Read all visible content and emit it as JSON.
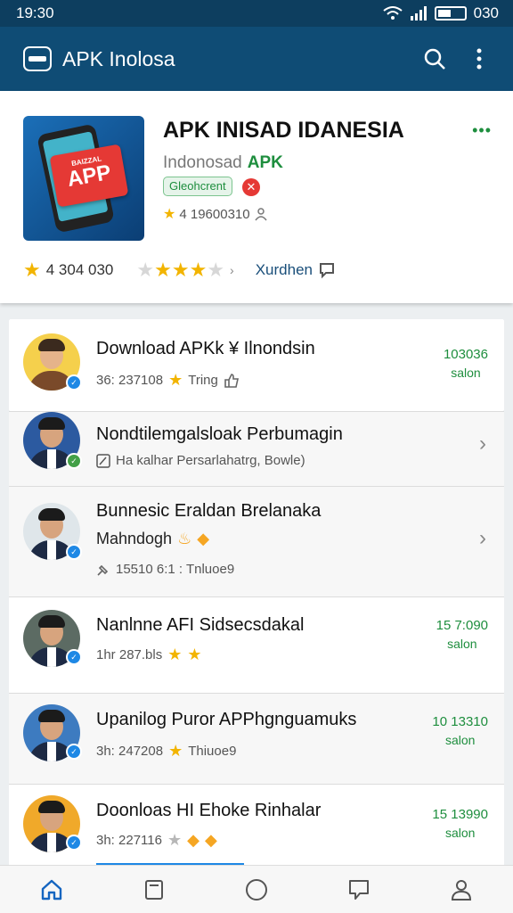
{
  "status": {
    "time": "19:30",
    "right_text": "030"
  },
  "appbar": {
    "title": "APK Inolosa"
  },
  "featured": {
    "title": "APK INISAD IDANESIA",
    "subtitle": "Indonosad",
    "subtitle_accent": "APK",
    "tag": "Gleohcrent",
    "rating_text": "4 19600310",
    "star_rating": 4,
    "rating_count": "4 304 030",
    "second_rating": 3.5,
    "link": "Xurdhen",
    "icon_badge_small": "BAIZZAL",
    "icon_badge_big": "APP"
  },
  "list": [
    {
      "title": "Download APKk ¥ Ilnondsin",
      "meta": "36: 237108",
      "badge": "Tring",
      "right_value": "103036",
      "right_label": "salon"
    },
    {
      "title": "Nondtilemgalsloak Perbumagin",
      "sub": "Ha kalhar Persarlahatrg, Bowle)"
    },
    {
      "title": "Bunnesic Eraldan Brelanaka",
      "line2": "Mahndogh",
      "meta": "15510 6:1 : Tnluoe9"
    },
    {
      "title": "Nanlnne AFI Sidsecsdakal",
      "meta": "1hr 287.bls",
      "right_value": "15 7:090",
      "right_label": "salon"
    },
    {
      "title": "Upanilog Puror APPhgnguamuks",
      "meta": "3h: 247208",
      "badge": "Thiuoe9",
      "right_value": "10 13310",
      "right_label": "salon"
    },
    {
      "title": "Doonloas HI Ehoke Rinhalar",
      "meta": "3h: 227116",
      "right_value": "15 13990",
      "right_label": "salon"
    }
  ]
}
